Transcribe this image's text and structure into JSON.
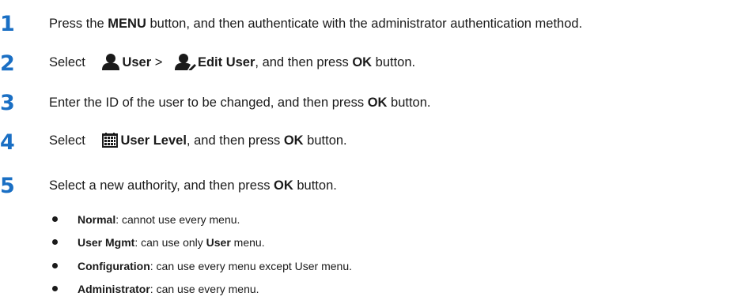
{
  "steps": [
    {
      "number": "1",
      "parts": {
        "a": "Press the ",
        "b": "MENU",
        "c": " button, and then authenticate with the administrator authentication method."
      }
    },
    {
      "number": "2",
      "parts": {
        "a": "Select ",
        "b": "User",
        "c": " > ",
        "d": "Edit User",
        "e": ", and then press ",
        "f": "OK",
        "g": " button."
      }
    },
    {
      "number": "3",
      "parts": {
        "a": "Enter the ID of the user to be changed, and then press ",
        "b": "OK",
        "c": " button."
      }
    },
    {
      "number": "4",
      "parts": {
        "a": "Select ",
        "b": "User Level",
        "c": ", and then press ",
        "d": "OK",
        "e": " button."
      }
    },
    {
      "number": "5",
      "parts": {
        "a": "Select a new authority, and then press ",
        "b": "OK",
        "c": " button."
      }
    }
  ],
  "authorities": [
    {
      "name": "Normal",
      "desc": ": cannot use every menu."
    },
    {
      "name": "User Mgmt",
      "desc_a": ": can use only ",
      "desc_b": "User",
      "desc_c": " menu."
    },
    {
      "name": "Configuration",
      "desc": ": can use every menu except User menu."
    },
    {
      "name": "Administrator",
      "desc": ": can use every menu."
    }
  ],
  "icons": {
    "user": "user-icon",
    "edit_user": "edit-user-icon",
    "user_level": "calendar-grid-icon"
  },
  "colors": {
    "step_number": "#1a6fc4",
    "text": "#1a1a1a"
  }
}
